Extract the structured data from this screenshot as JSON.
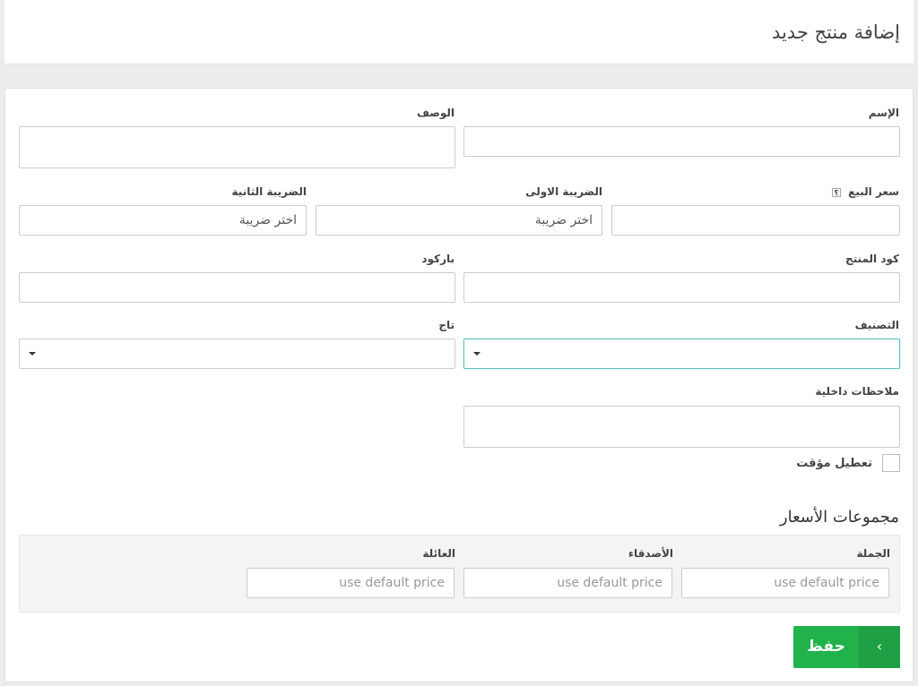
{
  "header": {
    "title": "إضافة منتج جديد"
  },
  "form": {
    "name_label": "الإسم",
    "description_label": "الوصف",
    "price_label": "سعر البيع",
    "help_icon_glyph": "؟",
    "tax1_label": "الضريبة الاولى",
    "tax1_placeholder": "اختر ضريبة",
    "tax2_label": "الضريبة الثانية",
    "tax2_placeholder": "اختر ضريبة",
    "code_label": "كود المنتج",
    "barcode_label": "باركود",
    "category_label": "التصنيف",
    "tag_label": "تاج",
    "notes_label": "ملاحظات داخلية",
    "disable_label": "تعطيل مؤقت",
    "disable_checked": false
  },
  "price_groups": {
    "title": "مجموعات الأسعار",
    "items": [
      {
        "label": "الجملة",
        "placeholder": "use default price"
      },
      {
        "label": "الأصدقاء",
        "placeholder": "use default price"
      },
      {
        "label": "العائلة",
        "placeholder": "use default price"
      }
    ]
  },
  "actions": {
    "save_label": "حفظ",
    "save_arrow_glyph": "‹"
  },
  "colors": {
    "accent_green": "#22b24c",
    "focus_border": "#5bc0c6"
  }
}
